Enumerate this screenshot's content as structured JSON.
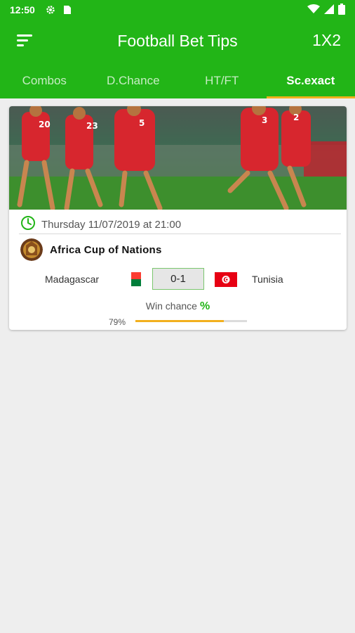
{
  "status_bar": {
    "time": "12:50",
    "icons": [
      "settings-icon",
      "sim-card-icon",
      "wifi-icon",
      "signal-icon",
      "battery-icon"
    ]
  },
  "app_bar": {
    "title": "Football Bet Tips",
    "action_label": "1X2",
    "menu_icon": "menu-icon"
  },
  "tabs": [
    {
      "label": "Combos",
      "active": false
    },
    {
      "label": "D.Chance",
      "active": false
    },
    {
      "label": "HT/FT",
      "active": false
    },
    {
      "label": "Sc.exact",
      "active": true
    }
  ],
  "match": {
    "datetime": "Thursday 11/07/2019 at 21:00",
    "league": "Africa Cup of Nations",
    "home_team": "Madagascar",
    "away_team": "Tunisia",
    "score": "0-1",
    "win_chance_label": "Win chance",
    "win_chance_symbol": "%",
    "win_chance_value": "79%",
    "win_chance_fraction": 0.79
  },
  "colors": {
    "primary_green": "#22b517",
    "accent_yellow": "#f2b01e",
    "tunisia_red": "#e70013"
  }
}
